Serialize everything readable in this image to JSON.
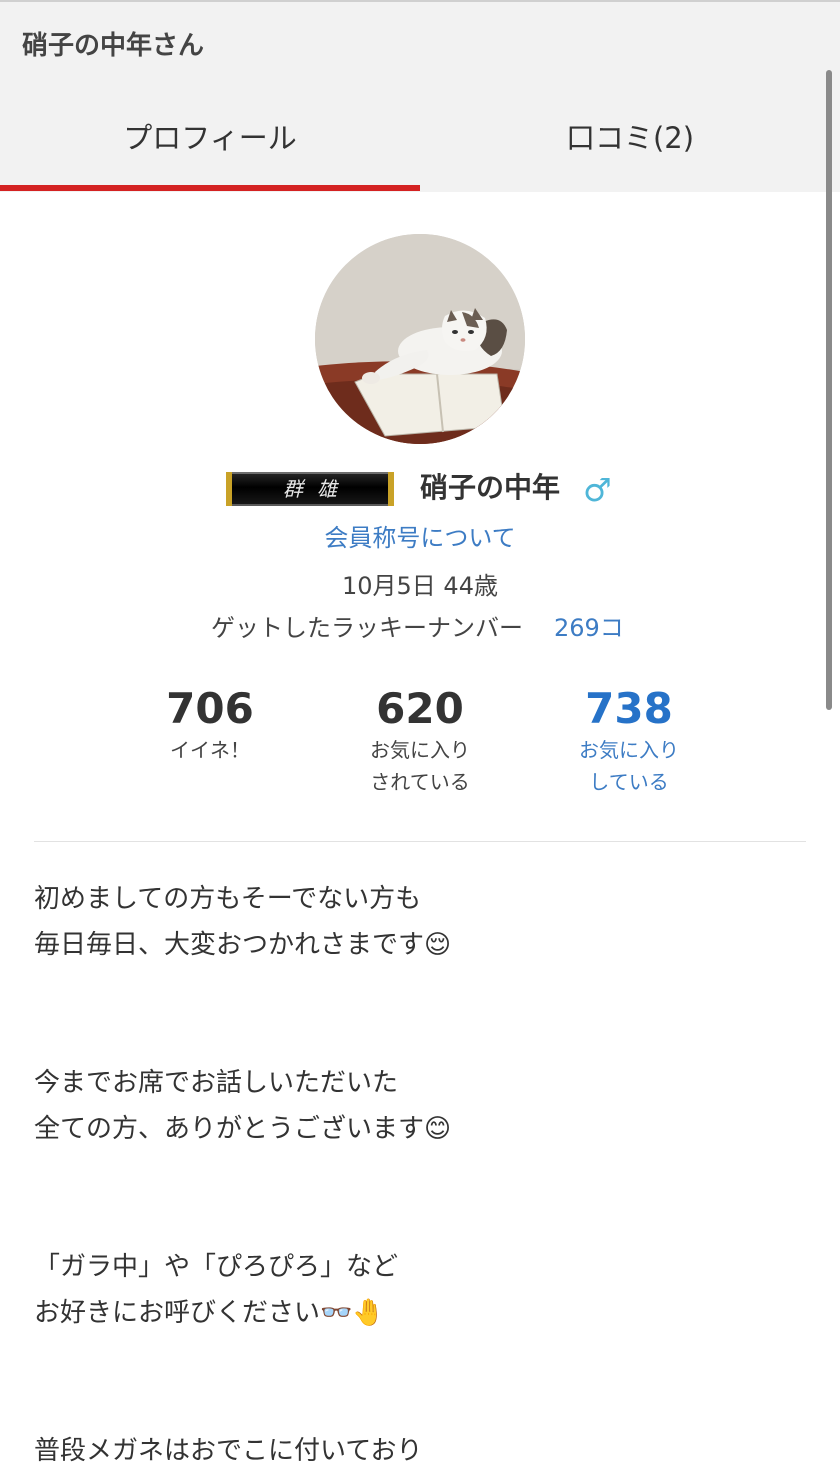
{
  "header": {
    "title": "硝子の中年さん",
    "tabs": [
      {
        "label": "プロフィール",
        "active": true
      },
      {
        "label": "口コミ(2)",
        "active": false
      }
    ],
    "accent_color": "#d42222"
  },
  "profile": {
    "avatar_icon": "cat-photo-avatar",
    "badge_text": "群雄",
    "name": "硝子の中年",
    "gender_icon": "male-icon",
    "gender_symbol": "♂",
    "title_link": "会員称号について",
    "birthday_age": "10月5日 44歳",
    "lucky_label": "ゲットしたラッキーナンバー",
    "lucky_count": "269コ"
  },
  "stats": [
    {
      "value": "706",
      "label": "イイネ！"
    },
    {
      "value": "620",
      "label": "お気に入り\nされている"
    },
    {
      "value": "738",
      "label": "お気に入り\nしている"
    }
  ],
  "bio": {
    "paragraphs": [
      [
        "初めましての方もそーでない方も",
        "毎日毎日、大変おつかれさまです😌"
      ],
      [
        "今までお席でお話しいただいた",
        "全ての方、ありがとうございます😊"
      ],
      [
        "「ガラ中」や「ぴろぴろ」など",
        "お好きにお呼びください👓🤚"
      ],
      [
        "普段メガネはおでこに付いており"
      ]
    ]
  },
  "colors": {
    "link": "#3d7cc4",
    "stat_highlight": "#2672c8",
    "gender": "#4fb6d8",
    "badge_gold": "#c9a227"
  }
}
